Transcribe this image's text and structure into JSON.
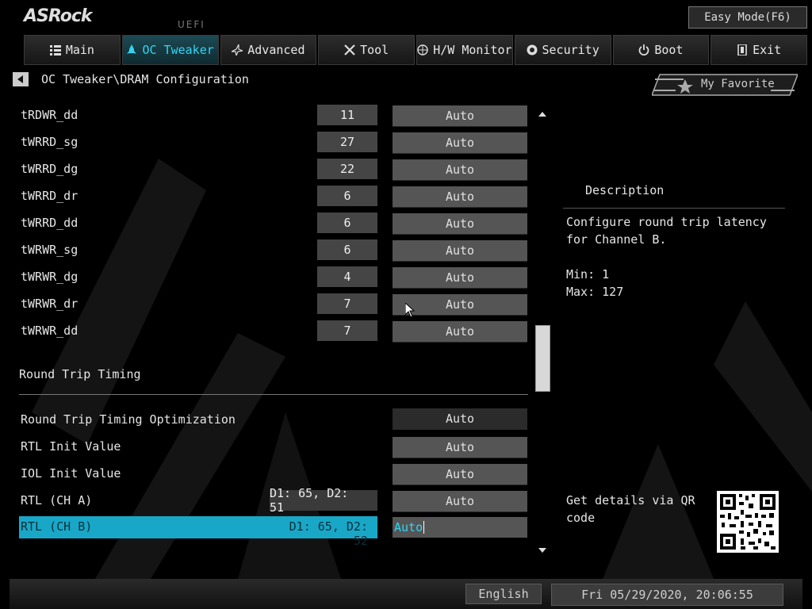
{
  "header": {
    "brand": "ASRock",
    "uefi_label": "UEFI",
    "easy_mode": "Easy Mode(F6)"
  },
  "tabs": [
    {
      "label": "Main",
      "icon": "list-icon"
    },
    {
      "label": "OC Tweaker",
      "icon": "rocket-icon"
    },
    {
      "label": "Advanced",
      "icon": "star-icon"
    },
    {
      "label": "Tool",
      "icon": "tools-icon"
    },
    {
      "label": "H/W Monitor",
      "icon": "monitor-icon"
    },
    {
      "label": "Security",
      "icon": "shield-icon"
    },
    {
      "label": "Boot",
      "icon": "power-icon"
    },
    {
      "label": "Exit",
      "icon": "exit-icon"
    }
  ],
  "active_tab": "OC Tweaker",
  "breadcrumb": "OC Tweaker\\DRAM Configuration",
  "favorite": "My Favorite",
  "timing_rows": [
    {
      "label": "tRDWR_dd",
      "value": "11",
      "setting": "Auto"
    },
    {
      "label": "tWRRD_sg",
      "value": "27",
      "setting": "Auto"
    },
    {
      "label": "tWRRD_dg",
      "value": "22",
      "setting": "Auto"
    },
    {
      "label": "tWRRD_dr",
      "value": "6",
      "setting": "Auto"
    },
    {
      "label": "tWRRD_dd",
      "value": "6",
      "setting": "Auto"
    },
    {
      "label": "tWRWR_sg",
      "value": "6",
      "setting": "Auto"
    },
    {
      "label": "tWRWR_dg",
      "value": "4",
      "setting": "Auto"
    },
    {
      "label": "tWRWR_dr",
      "value": "7",
      "setting": "Auto"
    },
    {
      "label": "tWRWR_dd",
      "value": "7",
      "setting": "Auto"
    }
  ],
  "section_title": "Round Trip Timing",
  "rtt_rows": [
    {
      "label": "Round Trip Timing Optimization",
      "setting": "Auto"
    },
    {
      "label": "RTL Init Value",
      "setting": "Auto"
    },
    {
      "label": "IOL Init Value",
      "setting": "Auto"
    },
    {
      "label": "RTL (CH A)",
      "value": "D1: 65, D2: 51",
      "setting": "Auto"
    }
  ],
  "selected_row": {
    "label": "RTL (CH B)",
    "value": "D1: 65, D2: 52",
    "setting": "Auto"
  },
  "description": {
    "title": "Description",
    "text": "Configure round trip latency for Channel B.",
    "min": "Min: 1",
    "max": "Max: 127",
    "qr_text": "Get details via QR code"
  },
  "footer": {
    "language": "English",
    "datetime": "Fri 05/29/2020, 20:06:55"
  },
  "colors": {
    "accent": "#19a7c7",
    "active_tab_text": "#33d4f0"
  }
}
